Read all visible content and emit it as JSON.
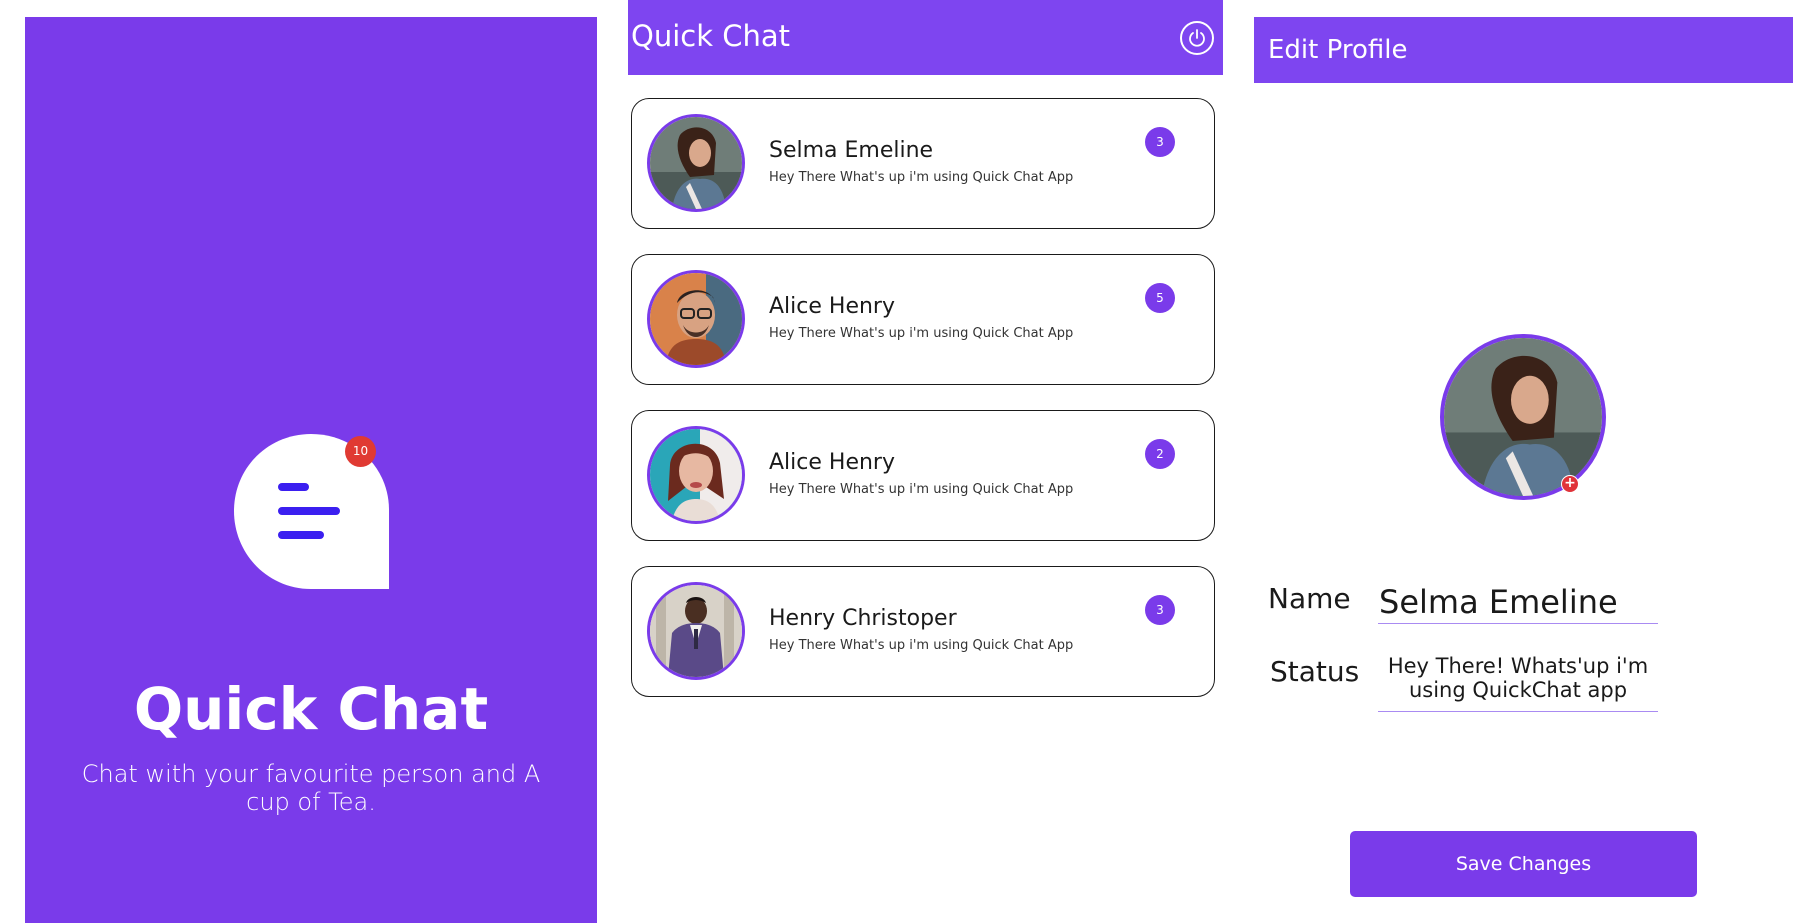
{
  "colors": {
    "primary": "#7a3bea",
    "header": "#7e45f0",
    "badge_red": "#e03a33",
    "logo_lines": "#3b1ff0",
    "underline": "#a98bf2"
  },
  "splash": {
    "logo_icon": "chat-bubble-icon",
    "badge_count": "10",
    "title": "Quick Chat",
    "tagline": "Chat with your favourite person and A cup of Tea."
  },
  "chat_list": {
    "header_title": "Quick Chat",
    "power_icon": "power-icon",
    "chats": [
      {
        "name": "Selma Emeline",
        "status": "Hey There What's up i'm using Quick Chat App",
        "unread": "3"
      },
      {
        "name": "Alice Henry",
        "status": "Hey There What's up i'm using Quick Chat App",
        "unread": "5"
      },
      {
        "name": "Alice Henry",
        "status": "Hey There What's up i'm using Quick Chat App",
        "unread": "2"
      },
      {
        "name": "Henry Christoper",
        "status": "Hey There What's up i'm using Quick Chat App",
        "unread": "3"
      }
    ]
  },
  "edit_profile": {
    "header_title": "Edit Profile",
    "add_photo_icon": "plus-icon",
    "name_label": "Name",
    "name_value": "Selma Emeline",
    "status_label": "Status",
    "status_value": "Hey There! Whats'up i'm using QuickChat app",
    "save_label": "Save Changes"
  }
}
